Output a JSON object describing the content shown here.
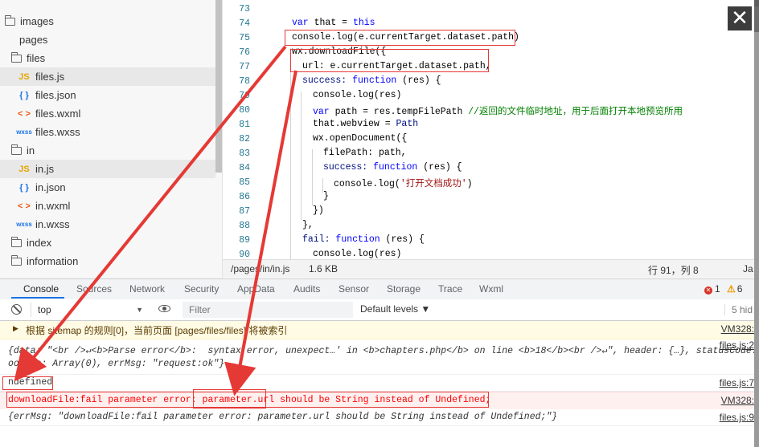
{
  "close_label": "✕",
  "file_tree": {
    "items": [
      {
        "name": "images",
        "kind": "folder"
      },
      {
        "name": "pages",
        "kind": "plain"
      },
      {
        "name": "files",
        "kind": "folder"
      },
      {
        "name": "files.js",
        "kind": "js",
        "icon": "JS"
      },
      {
        "name": "files.json",
        "kind": "json",
        "icon": "{ }"
      },
      {
        "name": "files.wxml",
        "kind": "wxml",
        "icon": "< >"
      },
      {
        "name": "files.wxss",
        "kind": "wxss",
        "icon": "wxss"
      },
      {
        "name": "in",
        "kind": "folder"
      },
      {
        "name": "in.js",
        "kind": "js",
        "icon": "JS"
      },
      {
        "name": "in.json",
        "kind": "json",
        "icon": "{ }"
      },
      {
        "name": "in.wxml",
        "kind": "wxml",
        "icon": "< >"
      },
      {
        "name": "in.wxss",
        "kind": "wxss",
        "icon": "wxss"
      },
      {
        "name": "index",
        "kind": "folder"
      },
      {
        "name": "information",
        "kind": "folder"
      }
    ]
  },
  "editor": {
    "line_numbers": [
      "73",
      "74",
      "75",
      "76",
      "77",
      "78",
      "79",
      "80",
      "81",
      "82",
      "83",
      "84",
      "85",
      "86",
      "87",
      "88",
      "89",
      "90"
    ],
    "code": {
      "l74_kw": "var",
      "l74_rest": " that = ",
      "l74_this": "this",
      "l75": "console.log(e.currentTarget.dataset.path)",
      "l76": "wx.downloadFile({",
      "l77": "url: e.currentTarget.dataset.path,",
      "l78_a": "success: ",
      "l78_kw": "function",
      "l78_b": " (res) {",
      "l79": "console.log(res)",
      "l80_kw": "var",
      "l80_a": " path = res.tempFilePath ",
      "l80_cmt": "//返回的文件临时地址，用于后面打开本地预览所用",
      "l81_a": "that.webview = ",
      "l81_b": "Path",
      "l82": "wx.openDocument({",
      "l83": "filePath: path,",
      "l84_a": "success: ",
      "l84_kw": "function",
      "l84_b": " (res) {",
      "l85_a": "console.log(",
      "l85_str": "'打开文档成功'",
      "l85_b": ")",
      "l86": "}",
      "l87": "})",
      "l88": "},",
      "l89_a": "fail: ",
      "l89_kw": "function",
      "l89_b": " (res) {",
      "l90": "console.log(res)"
    }
  },
  "statusbar": {
    "path": "/pages/in/in.js",
    "size": "1.6 KB",
    "position": "行 91，列 8",
    "lang": "Ja"
  },
  "devtools": {
    "tabs": [
      "Console",
      "Sources",
      "Network",
      "Security",
      "AppData",
      "Audits",
      "Sensor",
      "Storage",
      "Trace",
      "Wxml"
    ],
    "active_tab": "Console",
    "error_count": "1",
    "warning_count": "6",
    "context": "top",
    "filter_placeholder": "Filter",
    "levels": "Default levels ▼",
    "hidden": "5 hid"
  },
  "console": {
    "warn_text": "根据 sitemap 的规则[0]，当前页面 [pages/files/files] 将被索引",
    "warn_src": "VM328:",
    "info_line1": "{data: \"<br />↵<b>Parse error</b>:  syntax error, unexpect…' in <b>chapters.php</b> on line <b>18</b><br />↵\", header: {…}, statusCode: 200,",
    "info_line2": "ookies: Array(0), errMsg: \"request:ok\"}",
    "info_src": "files.js:2",
    "plain_text": "ndefined",
    "plain_src": "files.js:7",
    "err_text": "downloadFile:fail parameter error: parameter.url should be String instead of Undefined;",
    "err_src": "VM328:",
    "obj_text": "{errMsg: \"downloadFile:fail parameter error: parameter.url should be String instead of Undefined;\"}",
    "obj_src": "files.js:9"
  },
  "annotation_color": "#e53935"
}
